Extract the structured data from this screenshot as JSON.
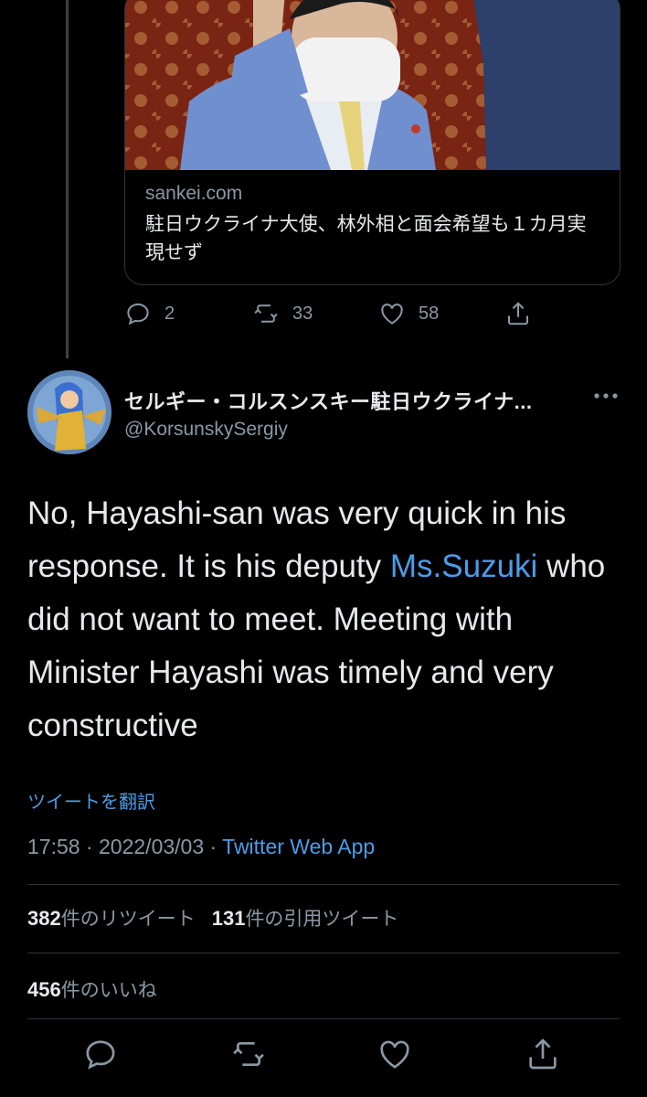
{
  "link_card": {
    "domain": "sankei.com",
    "title": "駐日ウクライナ大使、林外相と面会希望も１カ月実現せず"
  },
  "parent_actions": {
    "reply_count": "2",
    "retweet_count": "33",
    "like_count": "58"
  },
  "tweet": {
    "author_name": "セルギー・コルスンスキー駐日ウクライナ...",
    "author_handle": "@KorsunskySergiy",
    "text_before": "No, Hayashi-san was very quick in his response. It is his deputy ",
    "mention": "Ms.Suzuki",
    "text_after": " who did not want to meet. Meeting with Minister Hayashi was timely and very constructive",
    "translate_label": "ツイートを翻訳",
    "time": "17:58",
    "date": "2022/03/03",
    "separator": " · ",
    "source": "Twitter Web App"
  },
  "stats": {
    "retweets": "382",
    "retweets_label": "件のリツイート",
    "quotes": "131",
    "quotes_label": "件の引用ツイート",
    "likes": "456",
    "likes_label": "件のいいね"
  },
  "colors": {
    "background": "#000000",
    "text": "#e7e9ea",
    "secondary": "#8b98a5",
    "link": "#4c9ce8",
    "border": "#2f3336"
  },
  "icons": [
    "reply-icon",
    "retweet-icon",
    "like-icon",
    "share-icon",
    "more-icon"
  ]
}
